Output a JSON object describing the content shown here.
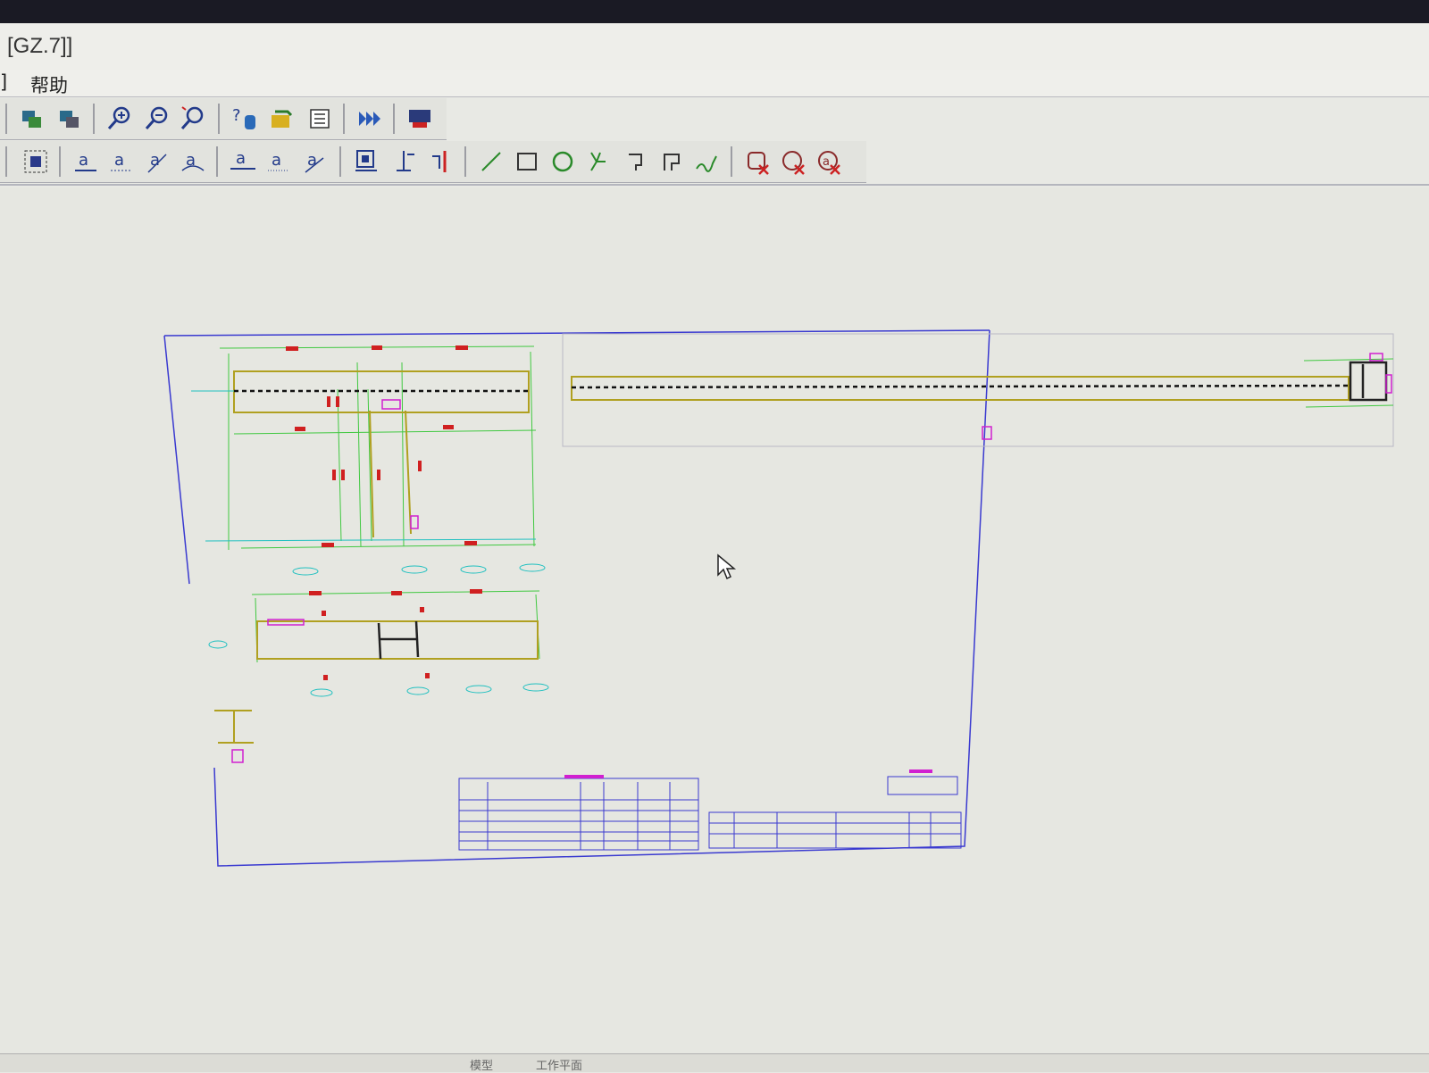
{
  "window": {
    "title": "[GZ.7]]"
  },
  "menu": {
    "items": [
      "]",
      "帮助"
    ]
  },
  "toolbar_primary": [
    "layer-icon",
    "layer-alt-icon",
    "zoom-in-icon",
    "zoom-out-icon",
    "zoom-window-icon",
    "help-icon",
    "export-icon",
    "list-icon",
    "forward-icon",
    "render-icon"
  ],
  "toolbar_draw": [
    "select-icon",
    "text-align-icon",
    "text-icon",
    "text-edit-icon",
    "text-rotate-icon",
    "text-insert-icon",
    "text-baseline-icon",
    "text-style-icon",
    "block-icon",
    "insert-point-icon",
    "dimension-icon",
    "line-icon",
    "rectangle-icon",
    "circle-icon",
    "snap-icon",
    "bracket-icon",
    "corner-icon",
    "curve-icon",
    "delete-icon",
    "delete-all-icon",
    "delete-text-icon"
  ],
  "canvas": {
    "border_color": "#3a3ad0",
    "steel_color": "#b0a020",
    "dimension_color": "#40c840",
    "mark_color": "#d02020",
    "label_color": "#d020d0",
    "axis_color": "#20c0c0"
  },
  "statusbar": {
    "tabs": [
      "模型",
      "工作平面"
    ]
  }
}
